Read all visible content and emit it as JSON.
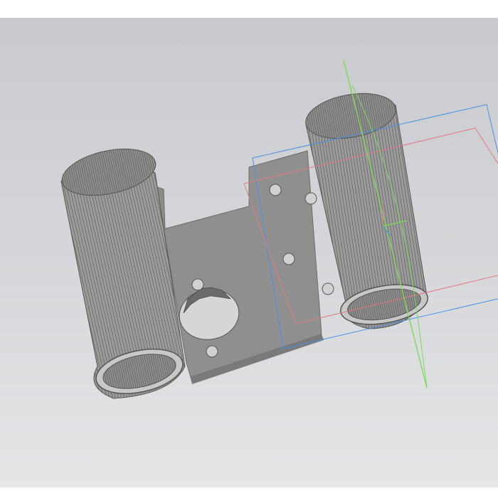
{
  "window": {
    "title": ""
  },
  "viewport": {
    "background_top": "#c9cace",
    "background_bottom": "#e4e5e7"
  },
  "model": {
    "part_fill": "#8f8f8f",
    "part_light": "#a8a8a8",
    "hatch_color": "#3e3e3e",
    "plane_colors": {
      "blue": "#4a90e2",
      "red": "#e07a80",
      "green": "#7ed957"
    }
  },
  "icons": {
    "origin_axes": "origin-axes-icon"
  }
}
